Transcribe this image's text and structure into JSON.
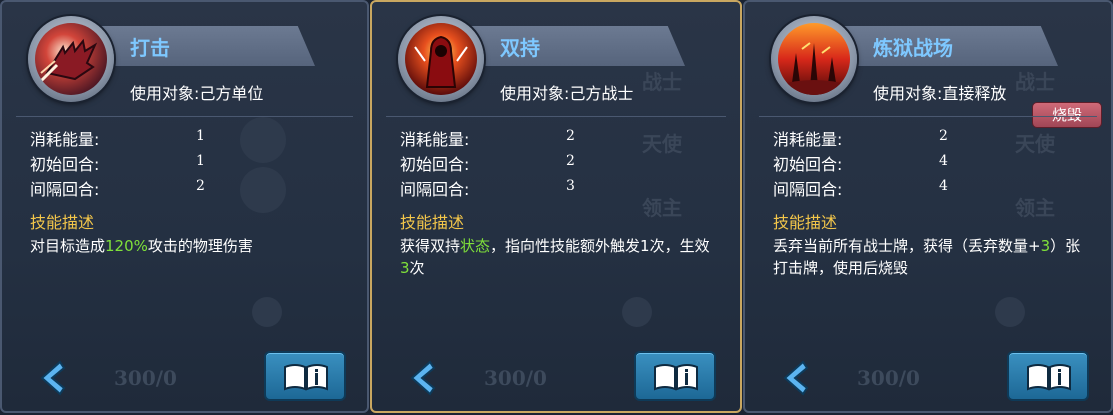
{
  "stat_labels": [
    "消耗能量:",
    "初始回合:",
    "间隔回合:"
  ],
  "desc_heading": "技能描述",
  "cards": [
    {
      "title": "打击",
      "target": "使用对象:己方单位",
      "stats": [
        "1",
        "1",
        "2"
      ],
      "desc_parts": [
        "对目标造成",
        "120%",
        "攻击的物理伤害"
      ],
      "badge": "",
      "bg_text": [
        "",
        "",
        ""
      ],
      "bg_number": "300/0"
    },
    {
      "title": "双持",
      "target": "使用对象:己方战士",
      "stats": [
        "2",
        "2",
        "3"
      ],
      "desc_parts": [
        "获得双持",
        "状态",
        "，指向性技能额外触发1次，生效",
        "3",
        "次"
      ],
      "badge": "",
      "bg_text": [
        "战士",
        "天使",
        "领主"
      ],
      "bg_number": "300/0"
    },
    {
      "title": "炼狱战场",
      "target": "使用对象:直接释放",
      "stats": [
        "2",
        "4",
        "4"
      ],
      "desc_parts": [
        "丢弃当前所有战士牌，获得（丢弃数量+",
        "3",
        "）张打击牌，使用后烧毁"
      ],
      "badge": "烧毁",
      "bg_text": [
        "战士",
        "天使",
        "领主"
      ],
      "bg_number": "300/0"
    }
  ],
  "colors": {
    "title": "#7ec8ff",
    "highlight": "#7fe03a",
    "heading": "#f3c64a",
    "selected_border": "#c9a760"
  },
  "icons": [
    "fist-icon",
    "dual-wield-icon",
    "inferno-battlefield-icon",
    "back-arrow-icon",
    "book-icon"
  ]
}
